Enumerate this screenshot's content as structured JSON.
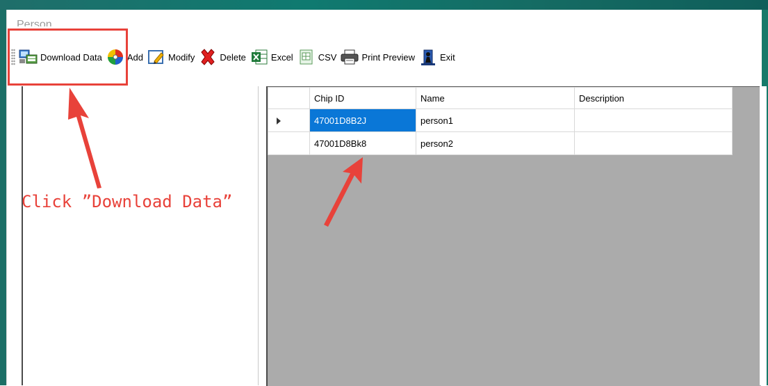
{
  "window": {
    "title": "Person"
  },
  "toolbar": {
    "buttons": [
      {
        "id": "download",
        "label": "Download Data",
        "icon": "download-data-icon"
      },
      {
        "id": "add",
        "label": "Add",
        "icon": "color-disc-icon"
      },
      {
        "id": "modify",
        "label": "Modify",
        "icon": "edit-pencil-icon"
      },
      {
        "id": "delete",
        "label": "Delete",
        "icon": "red-x-icon"
      },
      {
        "id": "excel",
        "label": "Excel",
        "icon": "excel-icon"
      },
      {
        "id": "csv",
        "label": "CSV",
        "icon": "csv-icon"
      },
      {
        "id": "print",
        "label": "Print Preview",
        "icon": "printer-icon"
      },
      {
        "id": "exit",
        "label": "Exit",
        "icon": "exit-door-icon"
      }
    ]
  },
  "grid": {
    "columns": [
      "Chip ID",
      "Name",
      "Description"
    ],
    "rows": [
      {
        "chip_id": "47001D8B2J",
        "name": "person1",
        "description": "",
        "current": true,
        "selected": true
      },
      {
        "chip_id": "47001D8Bk8",
        "name": "person2",
        "description": "",
        "current": false,
        "selected": false
      }
    ]
  },
  "annotation": {
    "text": "Click ”Download Data”",
    "color": "#e8423a"
  },
  "colors": {
    "titlebar": "#0f7a70",
    "selection": "#0a77d7",
    "grid_background": "#ababab",
    "annotation_red": "#e8423a"
  }
}
